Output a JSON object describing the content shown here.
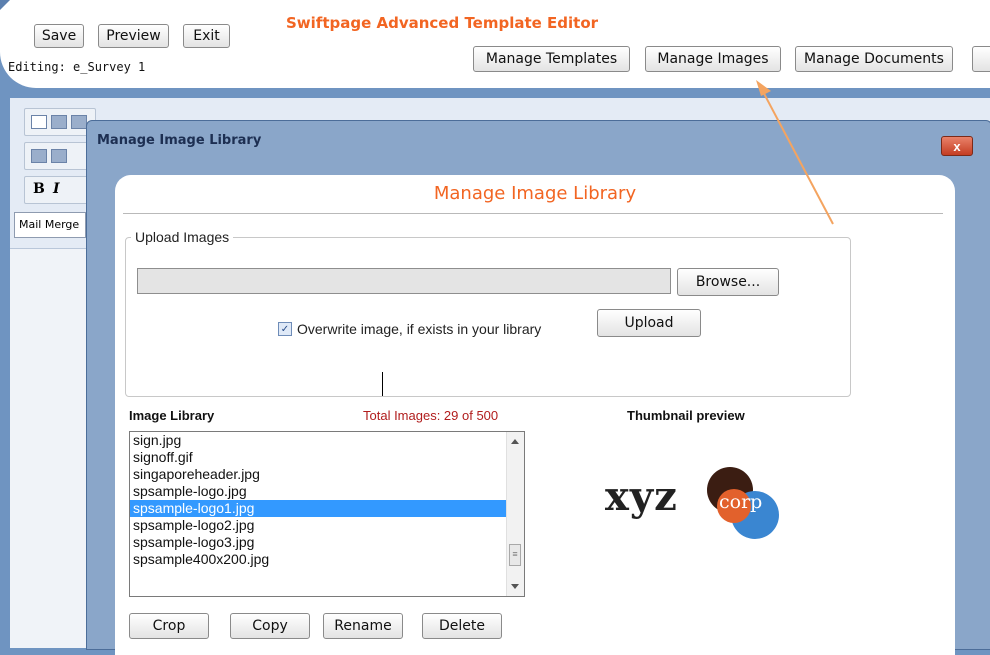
{
  "app": {
    "title": "Swiftpage Advanced Template Editor",
    "editing_label": "Editing: e_Survey 1"
  },
  "header_buttons": {
    "save": "Save",
    "preview": "Preview",
    "exit": "Exit",
    "manage_templates": "Manage Templates",
    "manage_images": "Manage Images",
    "manage_documents": "Manage Documents"
  },
  "editor": {
    "mail_merge": "Mail Merge"
  },
  "dialog": {
    "title": "Manage Image Library",
    "close": "x",
    "heading": "Manage Image Library",
    "upload": {
      "legend": "Upload Images",
      "browse": "Browse...",
      "overwrite_label": "Overwrite image, if exists in your library",
      "overwrite_checked": true,
      "upload_button": "Upload"
    },
    "library": {
      "label": "Image Library",
      "total": "Total Images: 29 of 500",
      "items": [
        "sign.jpg",
        "signoff.gif",
        "singaporeheader.jpg",
        "spsample-logo.jpg",
        "spsample-logo1.jpg",
        "spsample-logo2.jpg",
        "spsample-logo3.jpg",
        "spsample400x200.jpg"
      ],
      "selected_index": 4
    },
    "thumbnail": {
      "label": "Thumbnail preview",
      "logo_text_main": "xyz",
      "logo_text_sub": "corp"
    },
    "actions": {
      "crop": "Crop",
      "copy": "Copy",
      "rename": "Rename",
      "delete": "Delete"
    }
  },
  "colors": {
    "accent_orange": "#f26522",
    "selection_blue": "#3399ff",
    "total_red": "#b11d1d",
    "dialog_frame": "#8aa6c9"
  }
}
